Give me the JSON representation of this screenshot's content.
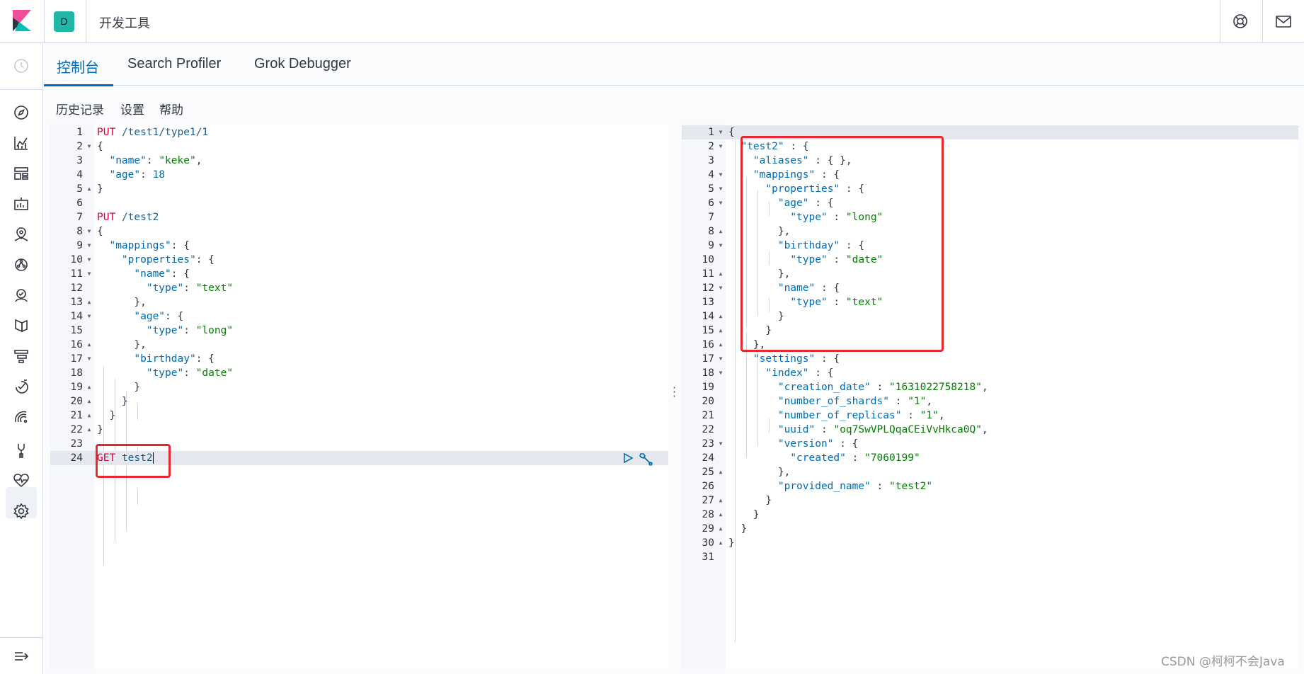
{
  "header": {
    "space_initial": "D",
    "breadcrumb": "开发工具"
  },
  "tabs": [
    "控制台",
    "Search Profiler",
    "Grok Debugger"
  ],
  "console_menu": {
    "history": "历史记录",
    "settings": "设置",
    "help": "帮助"
  },
  "request_editor": {
    "lines": [
      "1",
      "2",
      "3",
      "4",
      "5",
      "6",
      "7",
      "8",
      "9",
      "10",
      "11",
      "12",
      "13",
      "14",
      "15",
      "16",
      "17",
      "18",
      "19",
      "20",
      "21",
      "22",
      "23",
      "24"
    ],
    "active_line": 24
  },
  "response_editor": {
    "line_count": 31,
    "index_name": "test2",
    "creation_date": "1631022758218",
    "number_of_shards": "1",
    "number_of_replicas": "1",
    "uuid": "oq7SwVPLQqaCEiVvHkca0Q",
    "version_created": "7060199",
    "provided_name": "test2"
  },
  "colors": {
    "accent": "#006bb4",
    "method": "#d8003d",
    "string": "#007f00",
    "highlight_box": "#e8282f",
    "space_avatar": "#20b7a7"
  },
  "watermark": "CSDN @柯柯不会Java"
}
